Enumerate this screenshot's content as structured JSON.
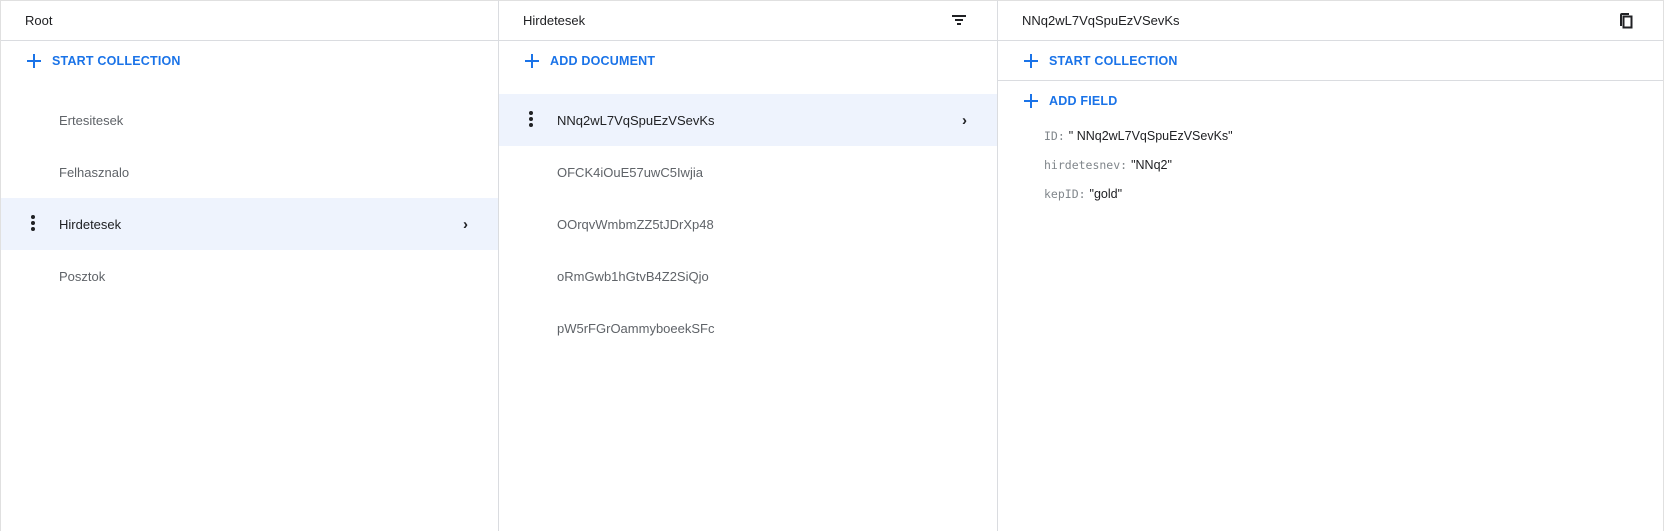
{
  "root_panel": {
    "title": "Root",
    "action": "START COLLECTION",
    "items": [
      "Ertesitesek",
      "Felhasznalo",
      "Hirdetesek",
      "Posztok"
    ],
    "selected": "Hirdetesek"
  },
  "collection_panel": {
    "title": "Hirdetesek",
    "action": "ADD DOCUMENT",
    "items": [
      "NNq2wL7VqSpuEzVSevKs",
      "OFCK4iOuE57uwC5Iwjia",
      "OOrqvWmbmZZ5tJDrXp48",
      "oRmGwb1hGtvB4Z2SiQjo",
      "pW5rFGrOammyboeekSFc"
    ],
    "selected": "NNq2wL7VqSpuEzVSevKs"
  },
  "document_panel": {
    "title": "NNq2wL7VqSpuEzVSevKs",
    "start_collection": "START COLLECTION",
    "add_field": "ADD FIELD",
    "fields": [
      {
        "key": "ID:",
        "value": "\" NNq2wL7VqSpuEzVSevKs\""
      },
      {
        "key": "hirdetesnev:",
        "value": "\"NNq2\""
      },
      {
        "key": "kepID:",
        "value": "\"gold\""
      }
    ]
  },
  "colors": {
    "accent": "#1a73e8",
    "selected_bg": "#eef3fd"
  }
}
